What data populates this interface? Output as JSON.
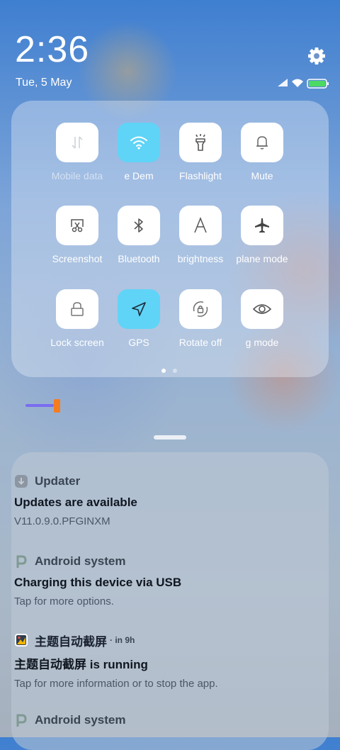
{
  "status": {
    "time": "2:36",
    "date": "Tue, 5 May"
  },
  "quick_settings": {
    "rows": [
      [
        {
          "label": "Mobile data",
          "icon": "mobile-data-icon",
          "active": false,
          "dim": true
        },
        {
          "label": "e   Dem",
          "icon": "wifi-icon",
          "active": true,
          "dim": false
        },
        {
          "label": "Flashlight",
          "icon": "flashlight-icon",
          "active": false,
          "dim": false
        },
        {
          "label": "Mute",
          "icon": "bell-icon",
          "active": false,
          "dim": false
        }
      ],
      [
        {
          "label": "Screenshot",
          "icon": "screenshot-icon",
          "active": false,
          "dim": false
        },
        {
          "label": "Bluetooth",
          "icon": "bluetooth-icon",
          "active": false,
          "dim": false
        },
        {
          "label": "brightness",
          "icon": "brightness-icon",
          "active": false,
          "dim": false
        },
        {
          "label": "plane mode",
          "icon": "airplane-icon",
          "active": false,
          "dim": false
        }
      ],
      [
        {
          "label": "Lock screen",
          "icon": "lock-icon",
          "active": false,
          "dim": false
        },
        {
          "label": "GPS",
          "icon": "gps-icon",
          "active": true,
          "dim": false
        },
        {
          "label": "Rotate off",
          "icon": "rotate-lock-icon",
          "active": false,
          "dim": false
        },
        {
          "label": "g mode",
          "icon": "eye-icon",
          "active": false,
          "dim": false
        }
      ]
    ],
    "page": 1,
    "page_count": 2,
    "brightness_level": 0.08,
    "colors": {
      "active": "#5fd4f7",
      "slider_track": "#7b6cf0",
      "slider_thumb": "#f57c1f"
    }
  },
  "notifications": [
    {
      "app": "Updater",
      "meta": "",
      "title": "Updates are available",
      "body": "V11.0.9.0.PFGINXM",
      "icon": "updater-icon"
    },
    {
      "app": "Android system",
      "meta": "",
      "title": "Charging this device via USB",
      "body": "Tap for more options.",
      "icon": "android-p-icon"
    },
    {
      "app": "主题自动截屏",
      "meta": "· in 9h",
      "title": "主题自动截屏 is running",
      "body": "Tap for more information or to stop the app.",
      "icon": "app-icon"
    },
    {
      "app": "Android system",
      "meta": "",
      "title": "",
      "body": "",
      "icon": "android-p-icon"
    }
  ]
}
